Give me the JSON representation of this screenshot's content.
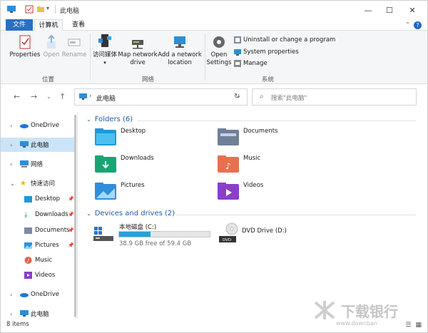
{
  "window": {
    "title": "此电脑"
  },
  "tabs": {
    "file": "文件",
    "computer": "计算机",
    "view": "查看"
  },
  "ribbon": {
    "location": {
      "label": "位置",
      "properties": "Properties",
      "open": "Open",
      "rename": "Rename"
    },
    "network": {
      "label": "网络",
      "access_media": "访问媒体",
      "map_drive_1": "Map network",
      "map_drive_2": "drive",
      "add_location_1": "Add a network",
      "add_location_2": "location"
    },
    "system": {
      "label": "系统",
      "open_settings_1": "Open",
      "open_settings_2": "Settings",
      "uninstall": "Uninstall or change a program",
      "system_properties": "System properties",
      "manage": "Manage"
    }
  },
  "address": {
    "path": "此电脑",
    "search_placeholder": "搜索\"此电脑\""
  },
  "nav": {
    "onedrive1": "OneDrive",
    "thispc": "此电脑",
    "network": "网络",
    "quick": "快速访问",
    "desktop": "Desktop",
    "downloads": "Downloads",
    "documents": "Documents",
    "pictures": "Pictures",
    "music": "Music",
    "videos": "Videos",
    "onedrive2": "OneDrive",
    "thispc2": "此电脑"
  },
  "content": {
    "folders_header": "Folders (6)",
    "folders": [
      "Desktop",
      "Documents",
      "Downloads",
      "Music",
      "Pictures",
      "Videos"
    ],
    "drives_header": "Devices and drives (2)",
    "drive_c": {
      "name": "本地磁盘 (C:)",
      "free": "38.9 GB free of 59.4 GB",
      "used_fraction": 0.345
    },
    "drive_d": {
      "name": "DVD Drive (D:)"
    }
  },
  "status": {
    "items": "8 items"
  },
  "watermark": {
    "brand": "下载银行",
    "site": "www.downban"
  },
  "colors": {
    "accent": "#2b6fc0",
    "selection": "#cce4f7",
    "drive_bar": "#26a0da"
  }
}
